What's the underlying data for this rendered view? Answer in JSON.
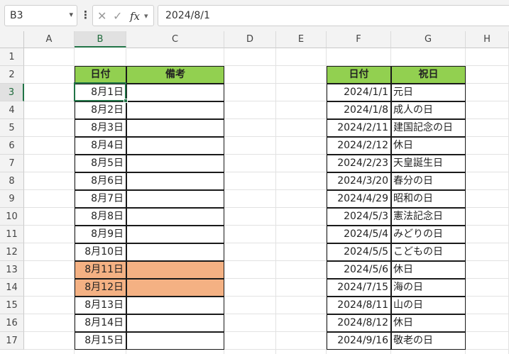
{
  "formula_bar": {
    "name_box": "B3",
    "formula": "2024/8/1"
  },
  "columns": [
    "A",
    "B",
    "C",
    "D",
    "E",
    "F",
    "G",
    "H"
  ],
  "rows": [
    "1",
    "2",
    "3",
    "4",
    "5",
    "6",
    "7",
    "8",
    "9",
    "10",
    "11",
    "12",
    "13",
    "14",
    "15",
    "16",
    "17"
  ],
  "left_table": {
    "headers": [
      "日付",
      "備考"
    ],
    "rows": [
      {
        "date": "8月1日",
        "note": ""
      },
      {
        "date": "8月2日",
        "note": ""
      },
      {
        "date": "8月3日",
        "note": ""
      },
      {
        "date": "8月4日",
        "note": ""
      },
      {
        "date": "8月5日",
        "note": ""
      },
      {
        "date": "8月6日",
        "note": ""
      },
      {
        "date": "8月7日",
        "note": ""
      },
      {
        "date": "8月8日",
        "note": ""
      },
      {
        "date": "8月9日",
        "note": ""
      },
      {
        "date": "8月10日",
        "note": ""
      },
      {
        "date": "8月11日",
        "note": "",
        "highlight": true
      },
      {
        "date": "8月12日",
        "note": "",
        "highlight": true
      },
      {
        "date": "8月13日",
        "note": ""
      },
      {
        "date": "8月14日",
        "note": ""
      },
      {
        "date": "8月15日",
        "note": ""
      }
    ]
  },
  "right_table": {
    "headers": [
      "日付",
      "祝日"
    ],
    "rows": [
      {
        "date": "2024/1/1",
        "name": "元日"
      },
      {
        "date": "2024/1/8",
        "name": "成人の日"
      },
      {
        "date": "2024/2/11",
        "name": "建国記念の日"
      },
      {
        "date": "2024/2/12",
        "name": "休日"
      },
      {
        "date": "2024/2/23",
        "name": "天皇誕生日"
      },
      {
        "date": "2024/3/20",
        "name": "春分の日"
      },
      {
        "date": "2024/4/29",
        "name": "昭和の日"
      },
      {
        "date": "2024/5/3",
        "name": "憲法記念日"
      },
      {
        "date": "2024/5/4",
        "name": "みどりの日"
      },
      {
        "date": "2024/5/5",
        "name": "こどもの日"
      },
      {
        "date": "2024/5/6",
        "name": "休日"
      },
      {
        "date": "2024/7/15",
        "name": "海の日"
      },
      {
        "date": "2024/8/11",
        "name": "山の日"
      },
      {
        "date": "2024/8/12",
        "name": "休日"
      },
      {
        "date": "2024/9/16",
        "name": "敬老の日"
      }
    ]
  },
  "colors": {
    "header_fill": "#92d050",
    "highlight_fill": "#f4b183",
    "selection": "#217346"
  }
}
